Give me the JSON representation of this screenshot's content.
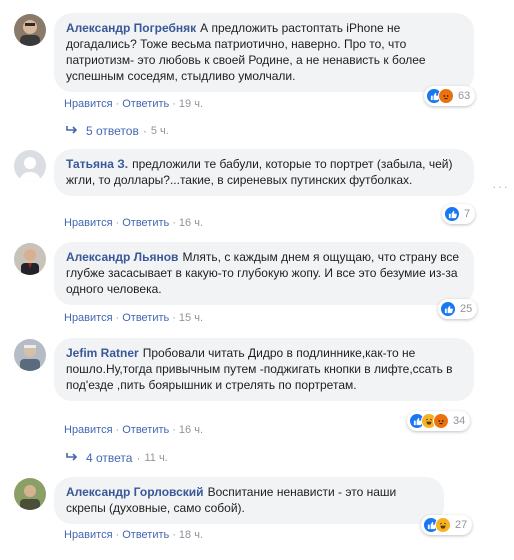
{
  "comments": [
    {
      "author": "Александр Погребняк",
      "text": "А предложить растоптать iPhone не догадались? Тоже весьма патриотично, наверно. Про то, что патриотизм- это любовь к своей Родине, а не ненависть к более успешным соседям, стыдливо умолчали.",
      "like": "Нравится",
      "reply": "Ответить",
      "time": "19 ч.",
      "reaction_count": "63",
      "replies": "5 ответов",
      "replies_time": "5 ч."
    },
    {
      "author": "Татьяна З.",
      "text": "предложили те бабули, которые то портрет (забыла, чей) жгли, то доллары?...такие, в сиреневых путинских футболках.",
      "like": "Нравится",
      "reply": "Ответить",
      "time": "16 ч.",
      "reaction_count": "7"
    },
    {
      "author": "Александр Льянов",
      "text": "Млять, с каждым днем я ощущаю, что страну все глубже засасывает в какую-то глубокую жопу. И все это безумие из-за одного человека.",
      "like": "Нравится",
      "reply": "Ответить",
      "time": "15 ч.",
      "reaction_count": "25"
    },
    {
      "author": "Jefim Ratner",
      "text": "Пробовали читать Дидро в подлиннике,как-то не пошло.Ну,тогда привычным путем -поджигать кнопки в лифте,ссать в под'езде ,пить боярышник и стрелять по портретам.",
      "like": "Нравится",
      "reply": "Ответить",
      "time": "16 ч.",
      "reaction_count": "34",
      "replies": "4 ответа",
      "replies_time": "11 ч."
    },
    {
      "author": "Александр Горловский",
      "text": "Воспитание ненависти - это наши скрепы (духовные, само собой).",
      "like": "Нравится",
      "reply": "Ответить",
      "time": "18 ч.",
      "reaction_count": "27"
    }
  ],
  "colors": {
    "author": "#385898",
    "link": "#4267b2",
    "bubble": "#f2f3f5",
    "like": "#1877f2",
    "angry": "#e9710f",
    "haha": "#f7b125"
  },
  "icons": [
    "like-icon",
    "angry-icon",
    "haha-icon",
    "reply-arrow-icon",
    "more-options-icon"
  ]
}
